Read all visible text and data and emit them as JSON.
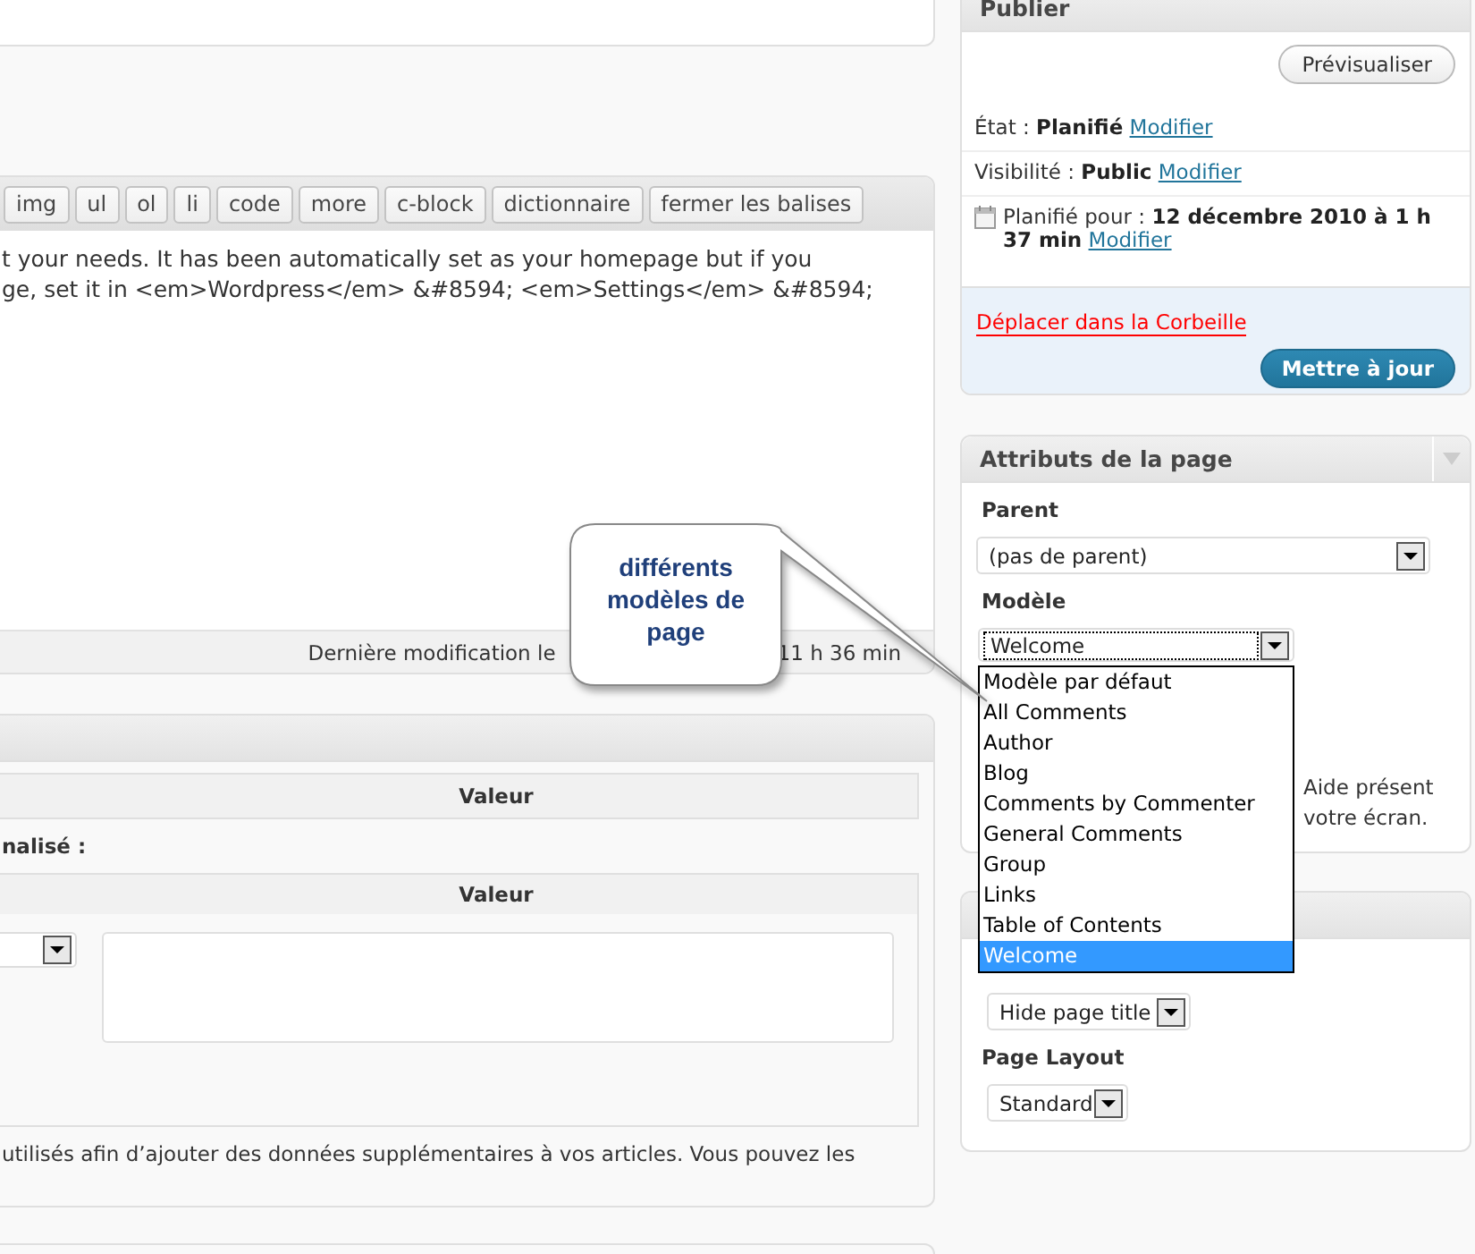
{
  "editor": {
    "toolbar_buttons": [
      "img",
      "ul",
      "ol",
      "li",
      "code",
      "more",
      "c-block",
      "dictionnaire",
      "fermer les balises"
    ],
    "content_lines": [
      "t your needs. It has been automatically set as your homepage but if you",
      "ge, set it in <em>Wordpress</em> &#8594; <em>Settings</em> &#8594;"
    ],
    "footer_left": "Dernière modification le",
    "footer_right": "11 h 36 min"
  },
  "callout": {
    "text": "différents modèles de page"
  },
  "custom_fields": {
    "table_heading": "Valeur",
    "label": "nalisé :",
    "form_heading": "Valeur",
    "help_text": "utilisés afin d’ajouter des données supplémentaires à vos articles. Vous pouvez les"
  },
  "publish": {
    "title": "Publier",
    "preview_button": "Prévisualiser",
    "rows": [
      {
        "kind": "status",
        "label": "État :",
        "value": "Planifié",
        "link": "Modifier"
      },
      {
        "kind": "visibility",
        "label": "Visibilité :",
        "value": "Public",
        "link": "Modifier"
      },
      {
        "kind": "schedule",
        "label": "Planifié pour :",
        "value": "12 décembre 2010 à 1 h 37 min",
        "link": "Modifier"
      }
    ],
    "trash_link": "Déplacer dans la Corbeille",
    "update_button": "Mettre à jour"
  },
  "page_attributes": {
    "title": "Attributs de la page",
    "parent_label": "Parent",
    "parent_value": "(pas de parent)",
    "template_label": "Modèle",
    "template_value": "Welcome",
    "template_options": [
      {
        "label": "Modèle par défaut",
        "selected": false
      },
      {
        "label": "All Comments",
        "selected": false
      },
      {
        "label": "Author",
        "selected": false
      },
      {
        "label": "Blog",
        "selected": false
      },
      {
        "label": "Comments by Commenter",
        "selected": false
      },
      {
        "label": "General Comments",
        "selected": false
      },
      {
        "label": "Group",
        "selected": false
      },
      {
        "label": "Links",
        "selected": false
      },
      {
        "label": "Table of Contents",
        "selected": false
      },
      {
        "label": "Welcome",
        "selected": true
      }
    ],
    "help_lines": [
      "Aide présent",
      "votre écran."
    ]
  },
  "layout_box": {
    "title_display": "Hide page title",
    "layout_label": "Page Layout",
    "layout_value": "Standard"
  }
}
